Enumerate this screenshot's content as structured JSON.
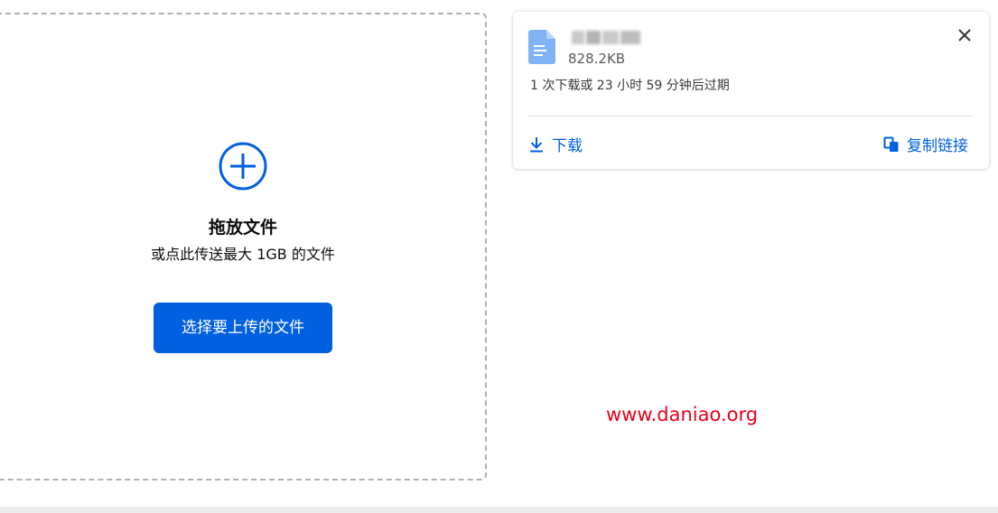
{
  "upload": {
    "title": "拖放文件",
    "subtitle": "或点此传送最大 1GB 的文件",
    "select_button_label": "选择要上传的文件"
  },
  "file_card": {
    "size": "828.2KB",
    "expiry": "1 次下载或 23 小时 59 分钟后过期",
    "download_label": "下载",
    "copy_link_label": "复制链接"
  },
  "watermark": {
    "text": "www.daniao.org"
  },
  "colors": {
    "accent": "#0060df",
    "file_icon": "#7fb3f5",
    "watermark": "#e8001c"
  },
  "icons": {
    "add": "plus-circle-icon",
    "file": "document-icon",
    "close": "close-icon",
    "download": "download-icon",
    "copy": "copy-icon"
  }
}
